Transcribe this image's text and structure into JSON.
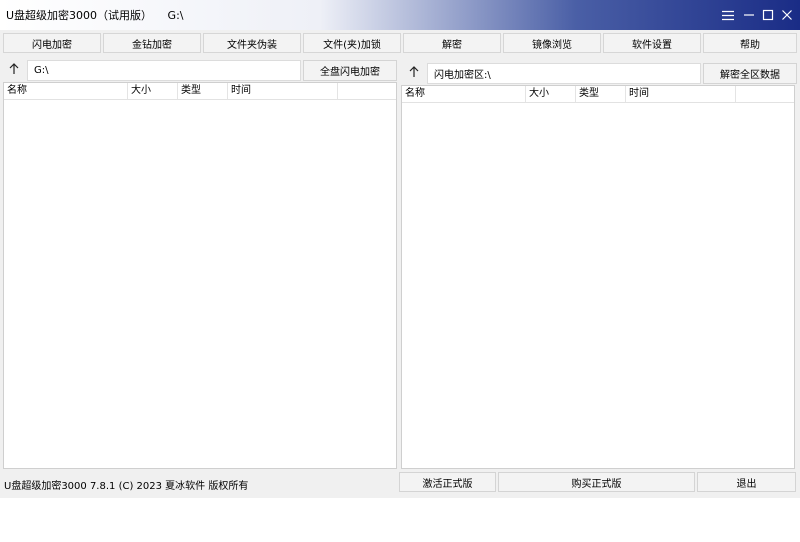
{
  "window": {
    "title": "U盘超级加密3000（试用版）",
    "path": "G:\\"
  },
  "toolbar": {
    "buttons": [
      {
        "label": "闪电加密"
      },
      {
        "label": "金钻加密"
      },
      {
        "label": "文件夹伪装"
      },
      {
        "label": "文件(夹)加锁"
      },
      {
        "label": "解密"
      },
      {
        "label": "镜像浏览"
      },
      {
        "label": "软件设置"
      },
      {
        "label": "帮助"
      }
    ]
  },
  "left_panel": {
    "path_value": "G:\\",
    "action_label": "全盘闪电加密",
    "columns": [
      "名称",
      "大小",
      "类型",
      "时间"
    ]
  },
  "right_panel": {
    "path_value": "闪电加密区:\\",
    "action_label": "解密全区数据",
    "columns": [
      "名称",
      "大小",
      "类型",
      "时间"
    ]
  },
  "footer": {
    "status": "U盘超级加密3000 7.8.1 (C) 2023 夏冰软件 版权所有",
    "activate_label": "激活正式版",
    "buy_label": "购买正式版",
    "exit_label": "退出"
  },
  "icons": {
    "menu": "menu-icon",
    "minimize": "minimize-icon",
    "maximize": "maximize-icon",
    "close": "close-icon",
    "up_left": "arrow-up-icon",
    "up_right": "arrow-up-icon"
  }
}
